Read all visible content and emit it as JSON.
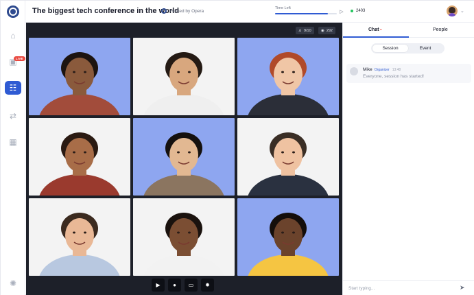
{
  "event": {
    "title": "The biggest tech conference in the world",
    "host_label": "Hosted by Opera"
  },
  "timer": {
    "label": "Time Left",
    "progress": 0.85
  },
  "online": {
    "count": "2403"
  },
  "sidebar": {
    "live_badge": "LIVE",
    "items": [
      {
        "icon": "home-icon",
        "glyph": "⌂"
      },
      {
        "icon": "live-stage-icon",
        "glyph": "▣"
      },
      {
        "icon": "sessions-icon",
        "glyph": "☷"
      },
      {
        "icon": "networking-icon",
        "glyph": "⇄"
      },
      {
        "icon": "expo-booth-icon",
        "glyph": "▦"
      },
      {
        "icon": "loading-icon",
        "glyph": "✺"
      }
    ]
  },
  "stage": {
    "participants": "9/10",
    "viewers": "292",
    "tiles": [
      {
        "bg": "blue",
        "skin": "#8a5a3c",
        "hair": "#1d1410",
        "shirt": "#a24c3b"
      },
      {
        "bg": "white",
        "skin": "#d8a77e",
        "hair": "#241a14",
        "shirt": "#efefef"
      },
      {
        "bg": "blue",
        "skin": "#f0c6a6",
        "hair": "#b04a2a",
        "shirt": "#2b2e38"
      },
      {
        "bg": "white",
        "skin": "#a86d48",
        "hair": "#2a1a12",
        "shirt": "#9a3a2e"
      },
      {
        "bg": "blue",
        "skin": "#e2b892",
        "hair": "#15110f",
        "shirt": "#8b7560"
      },
      {
        "bg": "white",
        "skin": "#efc2a1",
        "hair": "#3a2e25",
        "shirt": "#2a3140"
      },
      {
        "bg": "white",
        "skin": "#e9b896",
        "hair": "#3b2a1f",
        "shirt": "#b8c8e0"
      },
      {
        "bg": "white",
        "skin": "#7b4e33",
        "hair": "#1a120e",
        "shirt": "#f2f2f2"
      },
      {
        "bg": "blue",
        "skin": "#6b432c",
        "hair": "#140e0b",
        "shirt": "#f5c542"
      }
    ]
  },
  "controls": [
    {
      "name": "camera-button",
      "icon": "camera-icon",
      "glyph": "▶"
    },
    {
      "name": "microphone-button",
      "icon": "microphone-icon",
      "glyph": "●"
    },
    {
      "name": "screen-share-button",
      "icon": "monitor-icon",
      "glyph": "▭"
    },
    {
      "name": "settings-button",
      "icon": "gear-icon",
      "glyph": "✹"
    }
  ],
  "panel": {
    "tab_chat": "Chat",
    "tab_people": "People",
    "seg_session": "Session",
    "seg_event": "Event",
    "message": {
      "author": "Mike",
      "role": "Organizer",
      "time": "13:48",
      "text": "Everyone, session has started!"
    },
    "composer_placeholder": "Start typing..."
  },
  "colors": {
    "accent": "#2f5bd3",
    "stage_bg": "#1d2029",
    "online_dot": "#22c55e",
    "live": "#e9483f"
  }
}
